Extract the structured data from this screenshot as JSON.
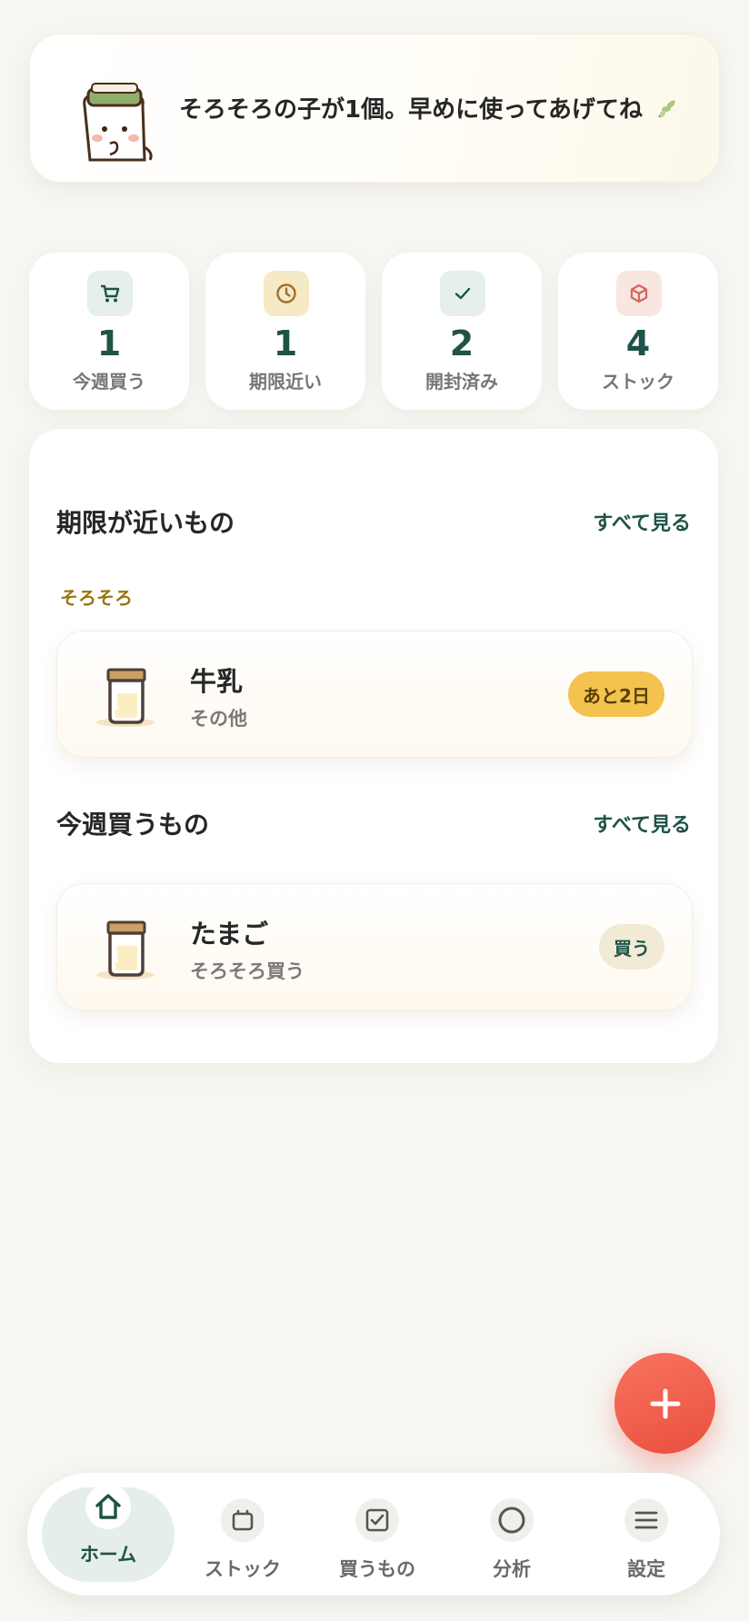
{
  "banner": {
    "message": "そろそろの子が1個。早めに使ってあげてね"
  },
  "stats": [
    {
      "icon": "cart-icon",
      "value": "1",
      "label": "今週買う",
      "color": "#1f5347",
      "bg": "#e6efea"
    },
    {
      "icon": "clock-icon",
      "value": "1",
      "label": "期限近い",
      "color": "#a0702a",
      "bg": "#f6e9c6"
    },
    {
      "icon": "check-icon",
      "value": "2",
      "label": "開封済み",
      "color": "#1f5347",
      "bg": "#e6efea"
    },
    {
      "icon": "box-icon",
      "value": "4",
      "label": "ストック",
      "color": "#d6665a",
      "bg": "#f8e6e3"
    }
  ],
  "expiring": {
    "title": "期限が近いもの",
    "see_all": "すべて見る",
    "group": "そろそろ",
    "items": [
      {
        "icon": "jar-icon",
        "name": "牛乳",
        "sub": "その他",
        "badge": "あと2日",
        "badge_bg": "#f3c24f",
        "badge_color": "#5a3f08"
      }
    ]
  },
  "shopping": {
    "title": "今週買うもの",
    "see_all": "すべて見る",
    "items": [
      {
        "icon": "jar-icon",
        "name": "たまご",
        "sub": "そろそろ買う",
        "badge": "買う",
        "badge_bg": "#f1ebd6",
        "badge_color": "#1f5347"
      }
    ]
  },
  "fab": {
    "icon": "plus-icon"
  },
  "nav": [
    {
      "icon": "home-icon",
      "label": "ホーム",
      "active": true
    },
    {
      "icon": "stock-icon",
      "label": "ストック",
      "active": false
    },
    {
      "icon": "checklist-icon",
      "label": "買うもの",
      "active": false
    },
    {
      "icon": "analytics-icon",
      "label": "分析",
      "active": false
    },
    {
      "icon": "menu-icon",
      "label": "設定",
      "active": false
    }
  ],
  "colors": {
    "accent": "#1f5347",
    "fab": "#ef5b4a",
    "background": "#f7f6f2"
  }
}
